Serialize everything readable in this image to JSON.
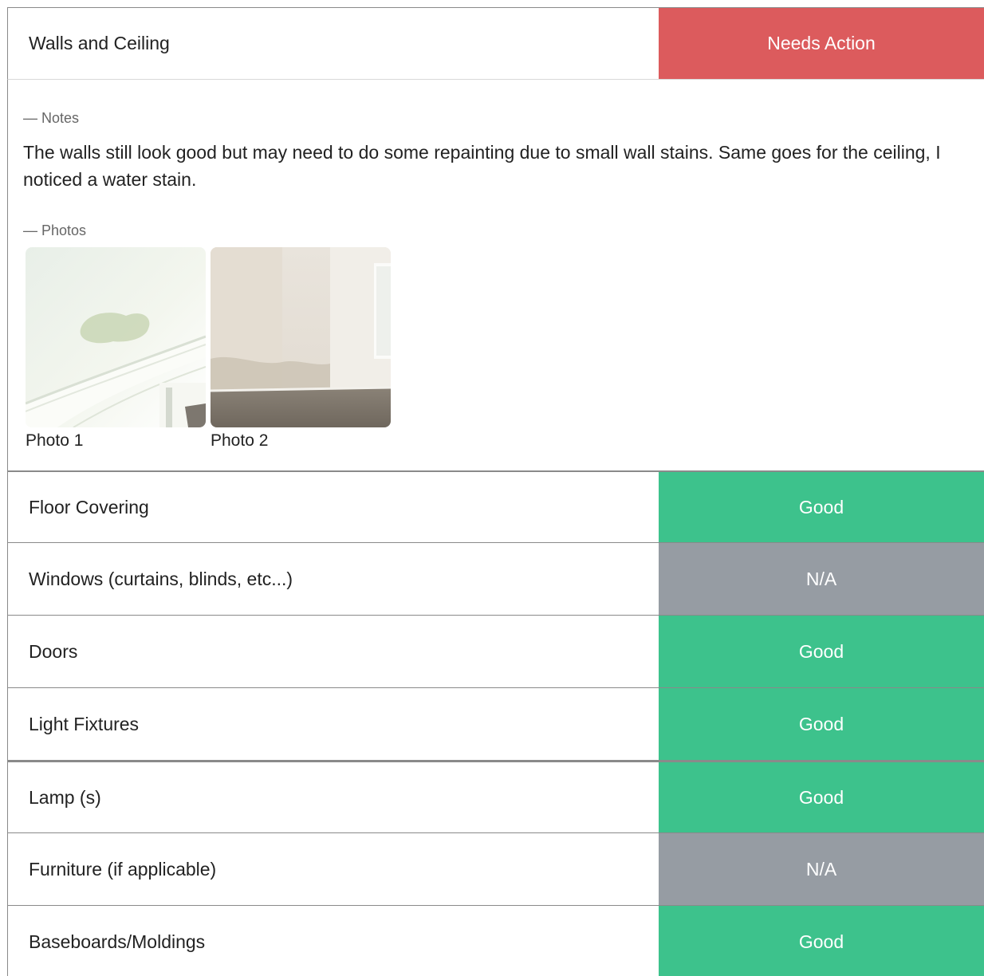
{
  "colors": {
    "needs_action": "#dc5b5d",
    "good": "#3dc28c",
    "na": "#969ca3"
  },
  "header": {
    "label": "Walls and Ceiling",
    "status": "Needs Action",
    "status_color": "#dc5b5d"
  },
  "detail": {
    "notes_label": "— Notes",
    "notes_text": "The walls still look good but may need to do some repainting due to small wall stains. Same goes for the ceiling, I noticed a water stain.",
    "photos_label": "— Photos",
    "photos": [
      {
        "caption": "Photo 1",
        "subject": "ceiling-water-stain"
      },
      {
        "caption": "Photo 2",
        "subject": "room-wall-stains"
      }
    ]
  },
  "items": [
    {
      "label": "Floor Covering",
      "status": "Good"
    },
    {
      "label": "Windows (curtains, blinds, etc...)",
      "status": "N/A"
    },
    {
      "label": "Doors",
      "status": "Good"
    },
    {
      "label": "Light Fixtures",
      "status": "Good"
    },
    {
      "label": "Lamp (s)",
      "status": "Good"
    },
    {
      "label": "Furniture (if applicable)",
      "status": "N/A"
    },
    {
      "label": "Baseboards/Moldings",
      "status": "Good"
    }
  ]
}
